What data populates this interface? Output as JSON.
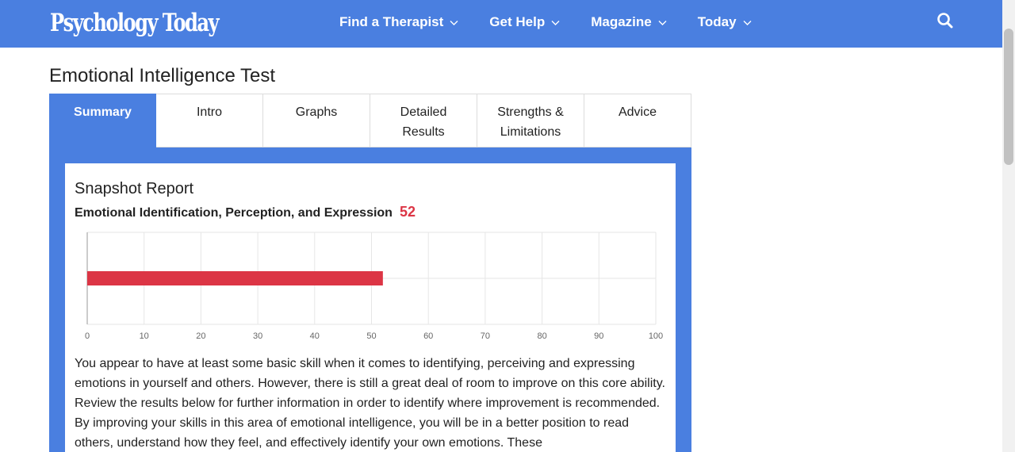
{
  "header": {
    "logo": "Psychology Today",
    "nav": [
      {
        "label": "Find a Therapist"
      },
      {
        "label": "Get Help"
      },
      {
        "label": "Magazine"
      },
      {
        "label": "Today"
      }
    ]
  },
  "page": {
    "title": "Emotional Intelligence Test"
  },
  "tabs": [
    {
      "label": "Summary",
      "active": true
    },
    {
      "label": "Intro"
    },
    {
      "label": "Graphs"
    },
    {
      "label": "Detailed Results"
    },
    {
      "label": "Strengths & Limitations"
    },
    {
      "label": "Advice"
    }
  ],
  "report": {
    "title": "Snapshot Report",
    "metric_label": "Emotional Identification, Perception, and Expression",
    "score": "52",
    "description": "You appear to have at least some basic skill when it comes to identifying, perceiving and expressing emotions in yourself and others. However, there is still a great deal of room to improve on this core ability. Review the results below for further information in order to identify where improvement is recommended. By improving your skills in this area of emotional intelligence, you will be in a better position to read others, understand how they feel, and effectively identify your own emotions. These"
  },
  "chart_data": {
    "type": "bar",
    "orientation": "horizontal",
    "categories": [
      ""
    ],
    "values": [
      52
    ],
    "xlim": [
      0,
      100
    ],
    "xticks": [
      0,
      10,
      20,
      30,
      40,
      50,
      60,
      70,
      80,
      90,
      100
    ],
    "grid": true,
    "bar_color": "#dc3545"
  },
  "colors": {
    "brand": "#4a7fe0",
    "score": "#dc3545"
  }
}
